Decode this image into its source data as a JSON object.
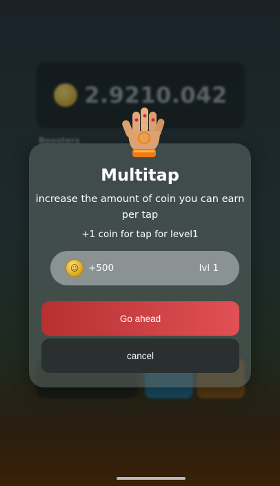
{
  "background": {
    "balance": "2.9210.042",
    "section_label": "Boosters"
  },
  "modal": {
    "title": "Multitap",
    "description": "increase the amount of coin you can earn per tap",
    "per_level_text": "+1 coin for tap for level1",
    "price": "+500",
    "level": "lvl 1",
    "go_ahead_label": "Go ahead",
    "cancel_label": "cancel"
  },
  "icons": {
    "booster": "glove-icon",
    "coin": "coin-icon"
  },
  "colors": {
    "primary_button": "#d84a4e",
    "secondary_button": "#2a2f2f",
    "price_pill": "#8a9292",
    "coin": "#d7a21c"
  }
}
